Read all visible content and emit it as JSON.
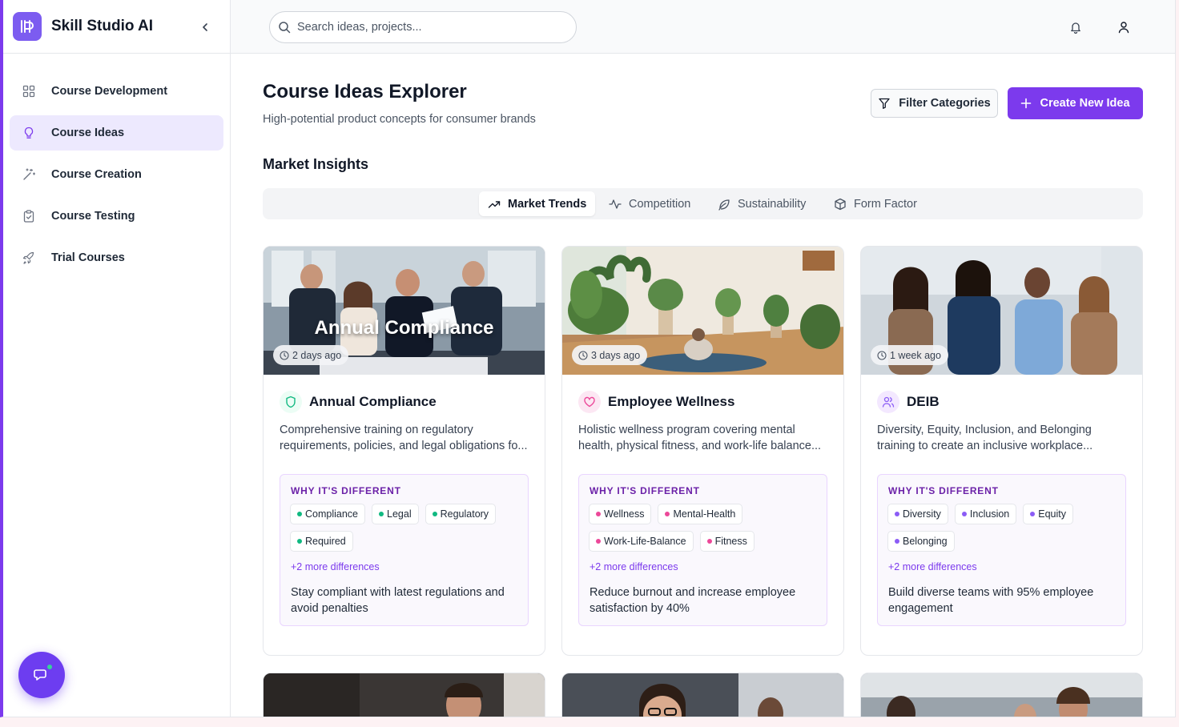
{
  "app": {
    "name": "Skill Studio AI"
  },
  "sidebar": {
    "items": [
      {
        "label": "Course Development",
        "icon": "grid-icon",
        "active": false
      },
      {
        "label": "Course Ideas",
        "icon": "lightbulb-icon",
        "active": true
      },
      {
        "label": "Course Creation",
        "icon": "magic-wand-icon",
        "active": false
      },
      {
        "label": "Course Testing",
        "icon": "clipboard-check-icon",
        "active": false
      },
      {
        "label": "Trial Courses",
        "icon": "rocket-icon",
        "active": false
      }
    ]
  },
  "header": {
    "search_placeholder": "Search ideas, projects..."
  },
  "page": {
    "title": "Course Ideas Explorer",
    "subtitle": "High-potential product concepts for consumer brands",
    "filter_label": "Filter Categories",
    "create_label": "Create New Idea",
    "section_title": "Market Insights"
  },
  "tabs": [
    {
      "label": "Market Trends",
      "icon": "trending-up-icon",
      "active": true
    },
    {
      "label": "Competition",
      "icon": "activity-icon",
      "active": false
    },
    {
      "label": "Sustainability",
      "icon": "leaf-icon",
      "active": false
    },
    {
      "label": "Form Factor",
      "icon": "box-icon",
      "active": false
    }
  ],
  "cards": [
    {
      "overlay": "Annual Compliance",
      "time": "2 days ago",
      "title": "Annual Compliance",
      "icon": "shield-icon",
      "description": "Comprehensive training on regulatory requirements, policies, and legal obligations fo...",
      "diff_title": "WHY IT'S DIFFERENT",
      "tags": [
        "Compliance",
        "Legal",
        "Regulatory",
        "Required"
      ],
      "more": "+2 more differences",
      "benefit": "Stay compliant with latest regulations and avoid penalties",
      "accent": "#10b981"
    },
    {
      "overlay": "",
      "time": "3 days ago",
      "title": "Employee Wellness",
      "icon": "heart-icon",
      "description": "Holistic wellness program covering mental health, physical fitness, and work-life balance...",
      "diff_title": "WHY IT'S DIFFERENT",
      "tags": [
        "Wellness",
        "Mental-Health",
        "Work-Life-Balance",
        "Fitness"
      ],
      "more": "+2 more differences",
      "benefit": "Reduce burnout and increase employee satisfaction by 40%",
      "accent": "#ec4899"
    },
    {
      "overlay": "",
      "time": "1 week ago",
      "title": "DEIB",
      "icon": "users-icon",
      "description": "Diversity, Equity, Inclusion, and Belonging training to create an inclusive workplace...",
      "diff_title": "WHY IT'S DIFFERENT",
      "tags": [
        "Diversity",
        "Inclusion",
        "Equity",
        "Belonging"
      ],
      "more": "+2 more differences",
      "benefit": "Build diverse teams with 95% employee engagement",
      "accent": "#8b5cf6"
    }
  ],
  "colors": {
    "primary": "#7c3aed",
    "active_nav_bg": "#ede9fe"
  }
}
